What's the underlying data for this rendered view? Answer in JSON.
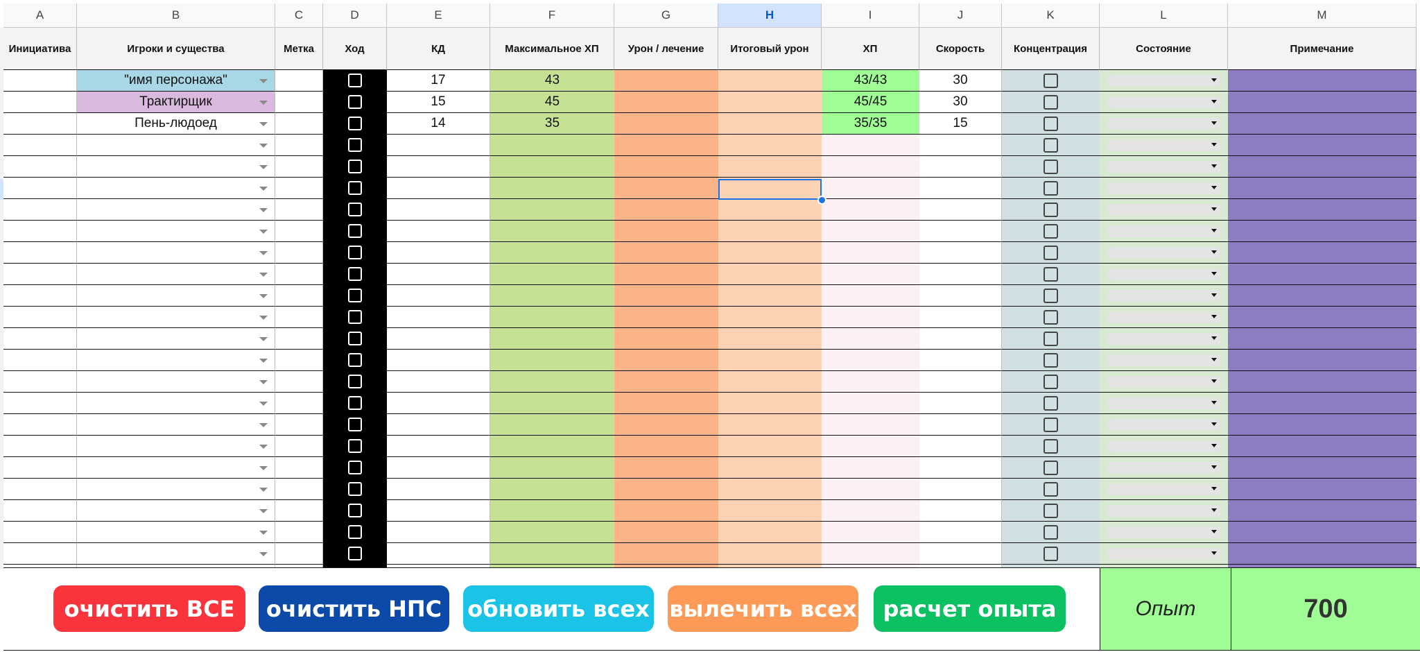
{
  "columns": [
    {
      "letter": "A",
      "header": "Инициатива"
    },
    {
      "letter": "B",
      "header": "Игроки и существа"
    },
    {
      "letter": "C",
      "header": "Метка"
    },
    {
      "letter": "D",
      "header": "Ход"
    },
    {
      "letter": "E",
      "header": "КД"
    },
    {
      "letter": "F",
      "header": "Максимальное ХП"
    },
    {
      "letter": "G",
      "header": "Урон / лечение"
    },
    {
      "letter": "H",
      "header": "Итоговый урон"
    },
    {
      "letter": "I",
      "header": "ХП"
    },
    {
      "letter": "J",
      "header": "Скорость"
    },
    {
      "letter": "K",
      "header": "Концентрация"
    },
    {
      "letter": "L",
      "header": "Состояние"
    },
    {
      "letter": "M",
      "header": "Примечание"
    }
  ],
  "selected_column": "H",
  "rows": [
    {
      "initiative": "",
      "name": "\"имя персонажа\"",
      "name_color": "#a8d7e6",
      "tag": "",
      "ac": "17",
      "max_hp": "43",
      "damage": "",
      "total_damage": "",
      "hp": "43/43",
      "speed": "30",
      "note": ""
    },
    {
      "initiative": "",
      "name": "Трактирщик",
      "name_color": "#d9b9dd",
      "tag": "",
      "ac": "15",
      "max_hp": "45",
      "damage": "",
      "total_damage": "",
      "hp": "45/45",
      "speed": "30",
      "note": ""
    },
    {
      "initiative": "",
      "name": "Пень-людоед",
      "name_color": "",
      "tag": "",
      "ac": "14",
      "max_hp": "35",
      "damage": "",
      "total_damage": "",
      "hp": "35/35",
      "speed": "15",
      "note": ""
    },
    {
      "initiative": "",
      "name": "",
      "name_color": "",
      "tag": "",
      "ac": "",
      "max_hp": "",
      "damage": "",
      "total_damage": "",
      "hp": "",
      "speed": "",
      "note": ""
    },
    {
      "initiative": "",
      "name": "",
      "name_color": "",
      "tag": "",
      "ac": "",
      "max_hp": "",
      "damage": "",
      "total_damage": "",
      "hp": "",
      "speed": "",
      "note": ""
    },
    {
      "initiative": "",
      "name": "",
      "name_color": "",
      "tag": "",
      "ac": "",
      "max_hp": "",
      "damage": "",
      "total_damage": "",
      "hp": "",
      "speed": "",
      "note": ""
    },
    {
      "initiative": "",
      "name": "",
      "name_color": "",
      "tag": "",
      "ac": "",
      "max_hp": "",
      "damage": "",
      "total_damage": "",
      "hp": "",
      "speed": "",
      "note": ""
    },
    {
      "initiative": "",
      "name": "",
      "name_color": "",
      "tag": "",
      "ac": "",
      "max_hp": "",
      "damage": "",
      "total_damage": "",
      "hp": "",
      "speed": "",
      "note": ""
    },
    {
      "initiative": "",
      "name": "",
      "name_color": "",
      "tag": "",
      "ac": "",
      "max_hp": "",
      "damage": "",
      "total_damage": "",
      "hp": "",
      "speed": "",
      "note": ""
    },
    {
      "initiative": "",
      "name": "",
      "name_color": "",
      "tag": "",
      "ac": "",
      "max_hp": "",
      "damage": "",
      "total_damage": "",
      "hp": "",
      "speed": "",
      "note": ""
    },
    {
      "initiative": "",
      "name": "",
      "name_color": "",
      "tag": "",
      "ac": "",
      "max_hp": "",
      "damage": "",
      "total_damage": "",
      "hp": "",
      "speed": "",
      "note": ""
    },
    {
      "initiative": "",
      "name": "",
      "name_color": "",
      "tag": "",
      "ac": "",
      "max_hp": "",
      "damage": "",
      "total_damage": "",
      "hp": "",
      "speed": "",
      "note": ""
    },
    {
      "initiative": "",
      "name": "",
      "name_color": "",
      "tag": "",
      "ac": "",
      "max_hp": "",
      "damage": "",
      "total_damage": "",
      "hp": "",
      "speed": "",
      "note": ""
    },
    {
      "initiative": "",
      "name": "",
      "name_color": "",
      "tag": "",
      "ac": "",
      "max_hp": "",
      "damage": "",
      "total_damage": "",
      "hp": "",
      "speed": "",
      "note": ""
    },
    {
      "initiative": "",
      "name": "",
      "name_color": "",
      "tag": "",
      "ac": "",
      "max_hp": "",
      "damage": "",
      "total_damage": "",
      "hp": "",
      "speed": "",
      "note": ""
    },
    {
      "initiative": "",
      "name": "",
      "name_color": "",
      "tag": "",
      "ac": "",
      "max_hp": "",
      "damage": "",
      "total_damage": "",
      "hp": "",
      "speed": "",
      "note": ""
    },
    {
      "initiative": "",
      "name": "",
      "name_color": "",
      "tag": "",
      "ac": "",
      "max_hp": "",
      "damage": "",
      "total_damage": "",
      "hp": "",
      "speed": "",
      "note": ""
    },
    {
      "initiative": "",
      "name": "",
      "name_color": "",
      "tag": "",
      "ac": "",
      "max_hp": "",
      "damage": "",
      "total_damage": "",
      "hp": "",
      "speed": "",
      "note": ""
    },
    {
      "initiative": "",
      "name": "",
      "name_color": "",
      "tag": "",
      "ac": "",
      "max_hp": "",
      "damage": "",
      "total_damage": "",
      "hp": "",
      "speed": "",
      "note": ""
    },
    {
      "initiative": "",
      "name": "",
      "name_color": "",
      "tag": "",
      "ac": "",
      "max_hp": "",
      "damage": "",
      "total_damage": "",
      "hp": "",
      "speed": "",
      "note": ""
    },
    {
      "initiative": "",
      "name": "",
      "name_color": "",
      "tag": "",
      "ac": "",
      "max_hp": "",
      "damage": "",
      "total_damage": "",
      "hp": "",
      "speed": "",
      "note": ""
    },
    {
      "initiative": "",
      "name": "",
      "name_color": "",
      "tag": "",
      "ac": "",
      "max_hp": "",
      "damage": "",
      "total_damage": "",
      "hp": "",
      "speed": "",
      "note": ""
    },
    {
      "initiative": "",
      "name": "",
      "name_color": "",
      "tag": "",
      "ac": "",
      "max_hp": "",
      "damage": "",
      "total_damage": "",
      "hp": "",
      "speed": "",
      "note": ""
    },
    {
      "initiative": "",
      "name": "",
      "name_color": "",
      "tag": "",
      "ac": "",
      "max_hp": "",
      "damage": "",
      "total_damage": "",
      "hp": "",
      "speed": "",
      "note": ""
    }
  ],
  "column_colors": {
    "F": "#c5e193",
    "G": "#fdb38a",
    "H": "#fdd3b4",
    "I_filled": "#a0fc94",
    "I_empty": "#fdf0f4",
    "K": "#d0e0e3",
    "L": "#d9ead3",
    "M": "#8e7cc3"
  },
  "buttons": [
    {
      "id": "clear-all",
      "label": "очистить ВСЕ",
      "color": "#f9343d"
    },
    {
      "id": "clear-npc",
      "label": "очистить НПС",
      "color": "#0b4aa8"
    },
    {
      "id": "refresh-all",
      "label": "обновить всех",
      "color": "#1bc3e6"
    },
    {
      "id": "heal-all",
      "label": "вылечить всех",
      "color": "#fd9a57"
    },
    {
      "id": "xp-calc",
      "label": "расчет опыта",
      "color": "#0cc161"
    }
  ],
  "xp": {
    "label": "Опыт",
    "value": "700"
  }
}
